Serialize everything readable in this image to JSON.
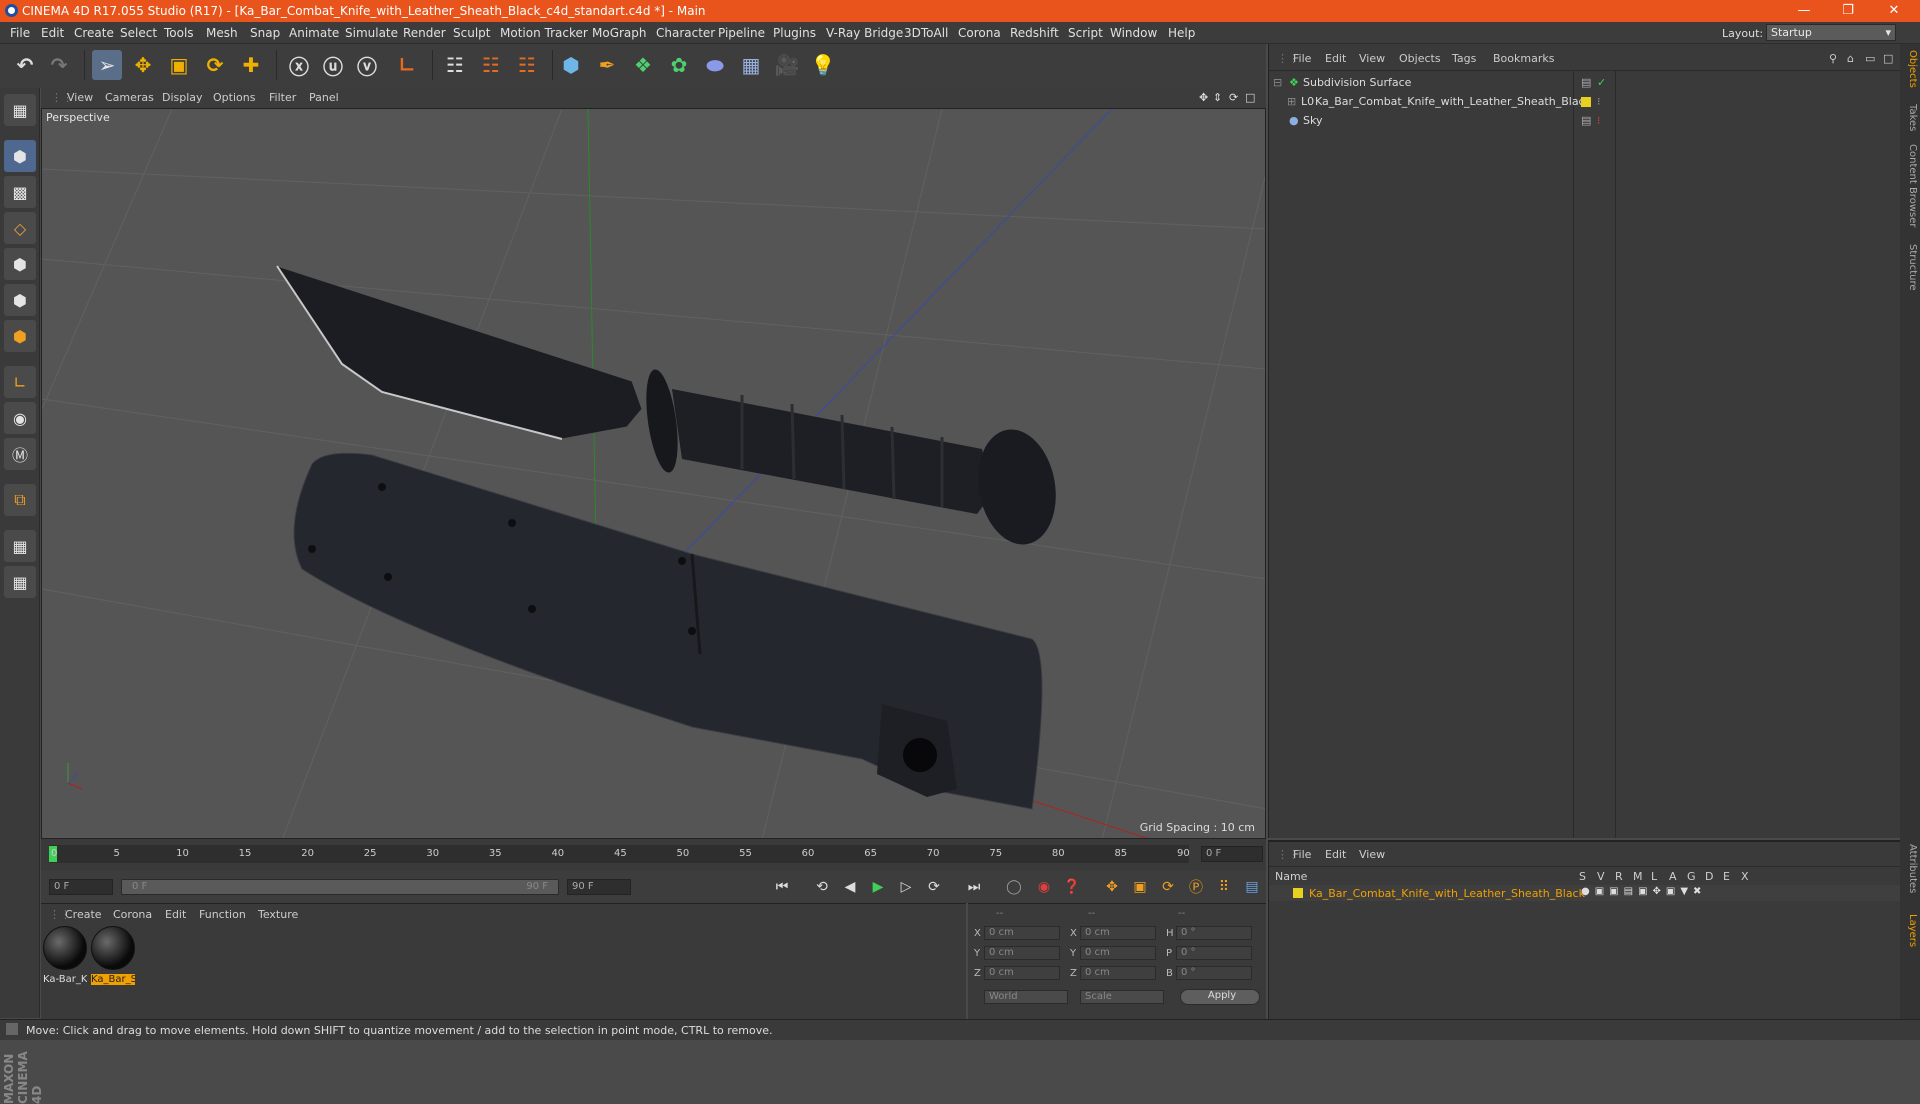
{
  "window": {
    "title": "CINEMA 4D R17.055 Studio (R17) - [Ka_Bar_Combat_Knife_with_Leather_Sheath_Black_c4d_standart.c4d *] - Main"
  },
  "menu": [
    "File",
    "Edit",
    "Create",
    "Select",
    "Tools",
    "Mesh",
    "Snap",
    "Animate",
    "Simulate",
    "Render",
    "Sculpt",
    "Motion Tracker",
    "MoGraph",
    "Character",
    "Pipeline",
    "Plugins",
    "V-Ray Bridge",
    "3DToAll",
    "Corona",
    "Redshift",
    "Script",
    "Window",
    "Help"
  ],
  "layout": {
    "label": "Layout:",
    "value": "Startup"
  },
  "viewport": {
    "menu": [
      "View",
      "Cameras",
      "Display",
      "Options",
      "Filter",
      "Panel"
    ],
    "camera": "Perspective",
    "grid_spacing": "Grid Spacing : 10 cm"
  },
  "timeline": {
    "ticks": [
      "0",
      "5",
      "10",
      "15",
      "20",
      "25",
      "30",
      "35",
      "40",
      "45",
      "50",
      "55",
      "60",
      "65",
      "70",
      "75",
      "80",
      "85",
      "90"
    ],
    "current_frame": "0 F",
    "start": "0 F",
    "range_start": "0 F",
    "range_end": "90 F",
    "end": "90 F"
  },
  "materials": {
    "menu": [
      "Create",
      "Corona",
      "Edit",
      "Function",
      "Texture"
    ],
    "items": [
      "Ka-Bar_K",
      "Ka_Bar_S"
    ]
  },
  "coords": {
    "header": [
      "--",
      "--",
      "--"
    ],
    "rows": [
      {
        "a": "X",
        "av": "0 cm",
        "b": "X",
        "bv": "0 cm",
        "c": "H",
        "cv": "0 °"
      },
      {
        "a": "Y",
        "av": "0 cm",
        "b": "Y",
        "bv": "0 cm",
        "c": "P",
        "cv": "0 °"
      },
      {
        "a": "Z",
        "av": "0 cm",
        "b": "Z",
        "bv": "0 cm",
        "c": "B",
        "cv": "0 °"
      }
    ],
    "world": "World",
    "scale": "Scale",
    "apply": "Apply"
  },
  "objects": {
    "menu": [
      "File",
      "Edit",
      "View",
      "Objects",
      "Tags",
      "Bookmarks"
    ],
    "items": [
      "Subdivision Surface",
      "Ka_Bar_Combat_Knife_with_Leather_Sheath_Black",
      "Sky"
    ]
  },
  "layers": {
    "menu": [
      "File",
      "Edit",
      "View"
    ],
    "cols": [
      "Name",
      "S",
      "V",
      "R",
      "M",
      "L",
      "A",
      "G",
      "D",
      "E",
      "X"
    ],
    "item": "Ka_Bar_Combat_Knife_with_Leather_Sheath_Black"
  },
  "sidetabs": [
    "Objects",
    "Takes",
    "Content Browser",
    "Structure",
    "Attributes",
    "Layers"
  ],
  "status": "Move: Click and drag to move elements. Hold down SHIFT to quantize movement / add to the selection in point mode, CTRL to remove.",
  "brand": "MAXON CINEMA 4D",
  "colors": {
    "title": "#e8541c",
    "accent": "#f0b000",
    "selected_tool": "#5a6e8a"
  }
}
